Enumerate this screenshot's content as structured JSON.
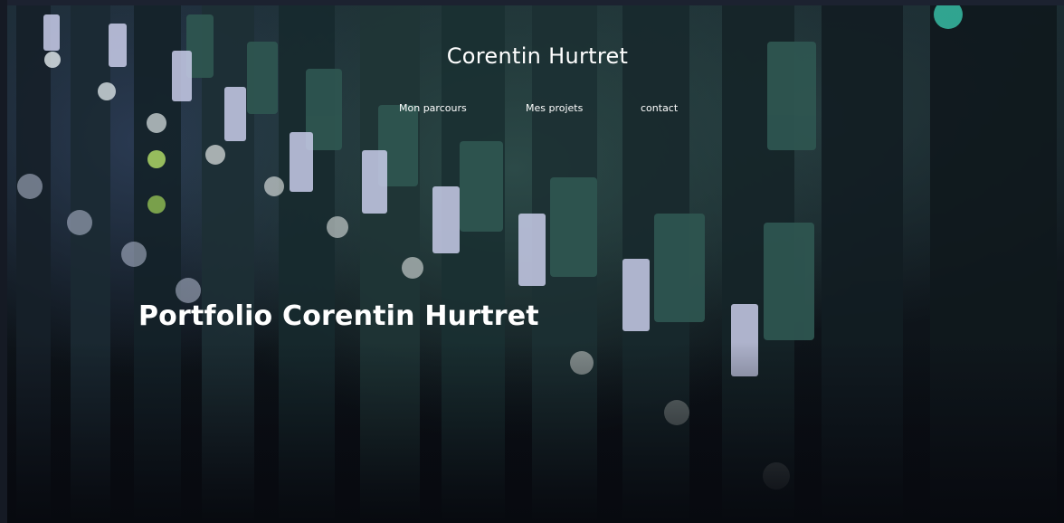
{
  "header": {
    "brand": "Corentin Hurtret",
    "nav": [
      {
        "label": "Mon parcours"
      },
      {
        "label": "Mes projets"
      },
      {
        "label": "contact"
      }
    ]
  },
  "hero": {
    "title": "Portfolio Corentin Hurtret",
    "background_image": "server-rack-photo"
  },
  "colors": {
    "text": "#ffffff",
    "background": "#0b0e14"
  }
}
